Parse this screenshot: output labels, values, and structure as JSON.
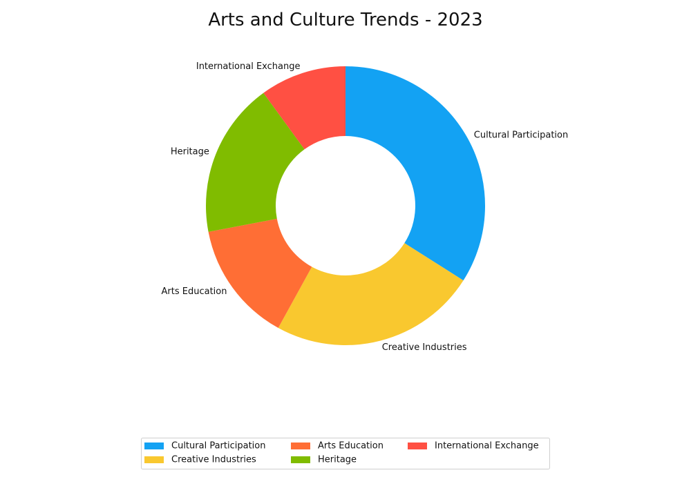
{
  "chart_data": {
    "type": "pie",
    "variant": "donut",
    "title": "Arts and Culture Trends - 2023",
    "categories": [
      "Cultural Participation",
      "Creative Industries",
      "Arts Education",
      "Heritage",
      "International Exchange"
    ],
    "values": [
      34,
      24,
      14,
      18,
      10
    ],
    "colors": [
      "#13a2f3",
      "#f9c82f",
      "#ff6e35",
      "#80bc00",
      "#ff5043"
    ],
    "start_angle_deg": 90,
    "direction": "clockwise",
    "legend": {
      "placement": "bottom-center",
      "columns": 3
    }
  }
}
